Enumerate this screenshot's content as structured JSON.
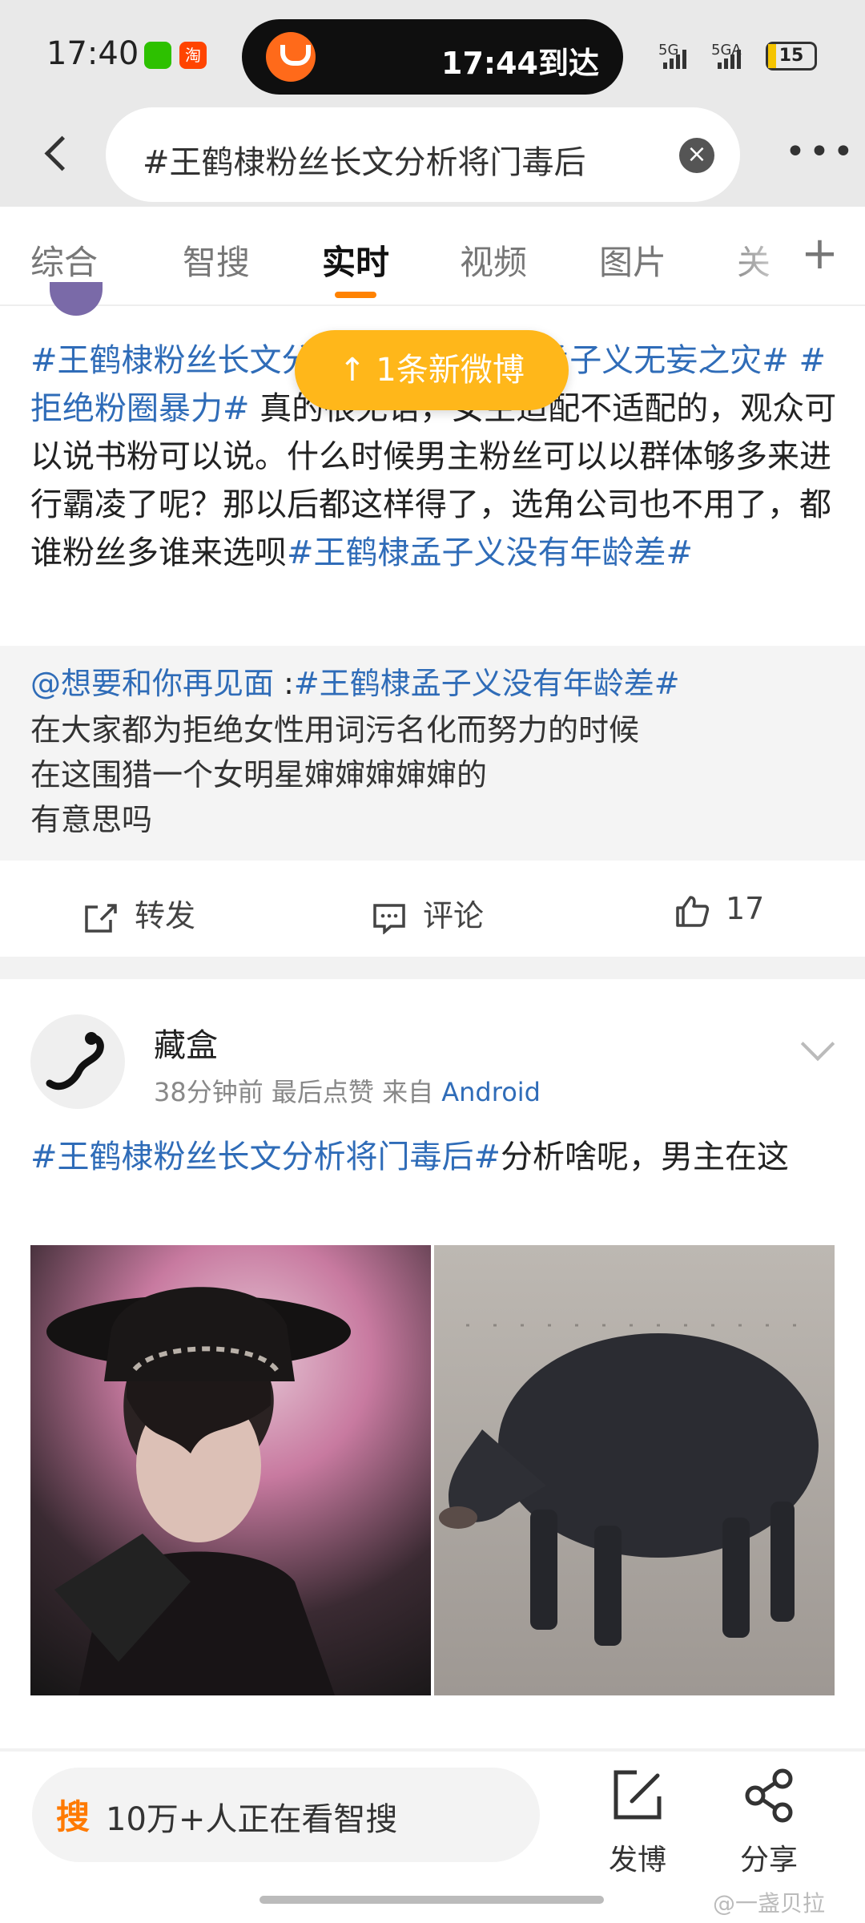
{
  "status_bar": {
    "time": "17:40",
    "taobao_label": "淘",
    "island_text": "17:44到达",
    "signal1": "5G",
    "signal2": "5GA",
    "battery": "15"
  },
  "search": {
    "query": "#王鹤棣粉丝长文分析将门毒后"
  },
  "tabs": [
    {
      "label": "综合"
    },
    {
      "label": "智搜"
    },
    {
      "label": "实时"
    },
    {
      "label": "视频"
    },
    {
      "label": "图片"
    },
    {
      "label": "关"
    }
  ],
  "new_posts_pill": "↑ 1条新微博",
  "post1": {
    "tag1": "#王鹤棣粉丝长文",
    "tag2": "分析将门毒后# #孟子义无妄之灾#",
    "tag3": "#拒绝粉圈暴力#",
    "body": "真的很无语，女主适配不适配的，观众可以说书粉可以说。什么时候男主粉丝可以以群体够多来进行霸凌了呢？那以后都这样得了，选角公司也不用了，都谁粉丝多谁来选呗",
    "tag4": "#王鹤棣孟子义没有年龄差#",
    "retweet": {
      "user": "@想要和你再见面",
      "sep": " :",
      "tag": "#王鹤棣孟子义没有年龄差#",
      "line1": "在大家都为拒绝女性用词污名化而努力的时候",
      "line2": "在这围猎一个女明星婶婶婶婶婶的",
      "line3": "有意思吗"
    },
    "actions": {
      "repost": "转发",
      "comment": "评论",
      "like": "17"
    }
  },
  "post2": {
    "name": "藏盒",
    "meta": "38分钟前 最后点赞  来自 ",
    "source": "Android",
    "tag": "#王鹤棣粉丝长文分析将门毒后#",
    "body": "分析啥呢，男主在这"
  },
  "bottom": {
    "zhisou_icon": "搜",
    "zhisou_text": "10万+人正在看智搜",
    "post_label": "发博",
    "share_label": "分享",
    "watermark": "@一盏贝拉"
  }
}
